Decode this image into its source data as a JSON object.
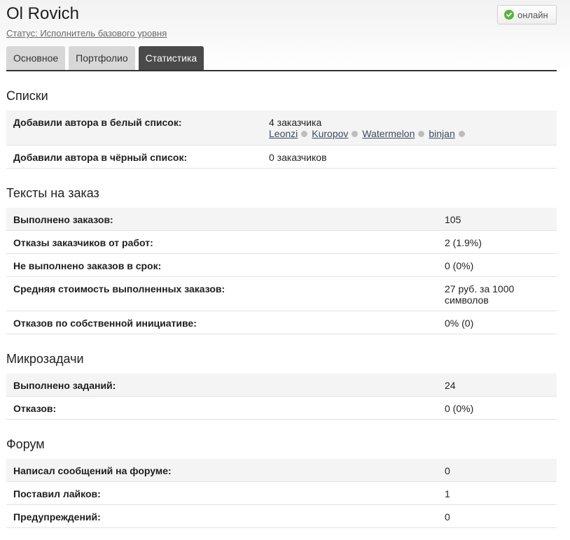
{
  "header": {
    "title": "Ol Rovich",
    "status": "Статус: Исполнитель базового уровня",
    "online": "онлайн"
  },
  "tabs": [
    {
      "label": "Основное",
      "active": false
    },
    {
      "label": "Портфолио",
      "active": false
    },
    {
      "label": "Статистика",
      "active": true
    }
  ],
  "lists": {
    "title": "Списки",
    "whitelist_label": "Добавили автора в белый список:",
    "whitelist_value": "4 заказчика",
    "whitelist_users": [
      "Leonzi",
      "Kuropov",
      "Watermelon",
      "binjan"
    ],
    "blacklist_label": "Добавили автора в чёрный список:",
    "blacklist_value": "0 заказчиков"
  },
  "texts": {
    "title": "Тексты на заказ",
    "rows": [
      {
        "label": "Выполнено заказов:",
        "value": "105"
      },
      {
        "label": "Отказы заказчиков от работ:",
        "value": "2 (1.9%)"
      },
      {
        "label": "Не выполнено заказов в срок:",
        "value": "0 (0%)"
      },
      {
        "label": "Средняя стоимость выполненных заказов:",
        "value_line1": "27 руб. за 1000",
        "value_line2": "символов"
      },
      {
        "label": "Отказов по собственной инициативе:",
        "value": "0% (0)"
      }
    ]
  },
  "micro": {
    "title": "Микрозадачи",
    "rows": [
      {
        "label": "Выполнено заданий:",
        "value": "24"
      },
      {
        "label": "Отказов:",
        "value": "0 (0%)"
      }
    ]
  },
  "forum": {
    "title": "Форум",
    "rows": [
      {
        "label": "Написал сообщений на форуме:",
        "value": "0"
      },
      {
        "label": "Поставил лайков:",
        "value": "1"
      },
      {
        "label": "Предупреждений:",
        "value": "0"
      }
    ]
  },
  "colors": {
    "tab_active": "#4a4a4a",
    "tab_inactive": "#d7d7d7",
    "online_dot": "#58b43c",
    "row_alt": "#f4f4f4"
  }
}
